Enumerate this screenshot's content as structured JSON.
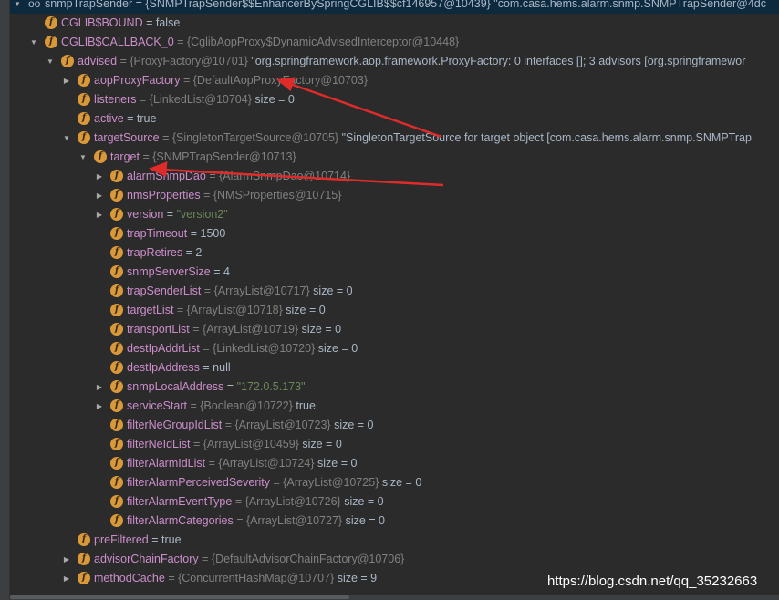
{
  "colors": {
    "background": "#2b2b2b",
    "selected_row": "#0d293e",
    "field_icon": "#d9993a",
    "field_name": "#cc8ecb",
    "reference": "#808080",
    "string": "#6a8759",
    "annotation_arrow": "#e02b2b"
  },
  "rows": [
    {
      "id": "snmp-trap-sender",
      "indent": 0,
      "arrow": "▼",
      "icon": "oo",
      "selected": true,
      "name": "snmpTrapSender",
      "ref": "",
      "value": "= {SNMPTrapSender$$EnhancerBySpringCGLIB$$cf146957@10439} \"com.casa.hems.alarm.snmp.SNMPTrapSender@4dc"
    },
    {
      "id": "cglib-bound",
      "indent": 1,
      "arrow": "",
      "icon": "f",
      "name": "CGLIB$BOUND",
      "ref": "",
      "value": "= false"
    },
    {
      "id": "cglib-callback-0",
      "indent": 1,
      "arrow": "▼",
      "icon": "f",
      "name": "CGLIB$CALLBACK_0",
      "ref": "= {CglibAopProxy$DynamicAdvisedInterceptor@10448}",
      "value": ""
    },
    {
      "id": "advised",
      "indent": 2,
      "arrow": "▼",
      "icon": "f",
      "name": "advised",
      "ref": "= {ProxyFactory@10701}",
      "value": "\"org.springframework.aop.framework.ProxyFactory: 0 interfaces []; 3 advisors [org.springframewor"
    },
    {
      "id": "aop-proxy-factory",
      "indent": 3,
      "arrow": "▶",
      "icon": "f",
      "name": "aopProxyFactory",
      "ref": "= {DefaultAopProxyFactory@10703}",
      "value": ""
    },
    {
      "id": "listeners",
      "indent": 3,
      "arrow": "",
      "icon": "f",
      "name": "listeners",
      "ref": "= {LinkedList@10704}",
      "value": "size = 0"
    },
    {
      "id": "active",
      "indent": 3,
      "arrow": "",
      "icon": "f",
      "name": "active",
      "ref": "",
      "value": "= true"
    },
    {
      "id": "target-source",
      "indent": 3,
      "arrow": "▼",
      "icon": "f",
      "name": "targetSource",
      "ref": "= {SingletonTargetSource@10705}",
      "value": "\"SingletonTargetSource for target object [com.casa.hems.alarm.snmp.SNMPTrap"
    },
    {
      "id": "target",
      "indent": 4,
      "arrow": "▼",
      "icon": "f",
      "name": "target",
      "ref": "= {SNMPTrapSender@10713}",
      "value": ""
    },
    {
      "id": "alarm-snmp-dao",
      "indent": 5,
      "arrow": "▶",
      "icon": "f",
      "name": "alarmSnmpDao",
      "ref": "= {AlarmSnmpDao@10714}",
      "value": ""
    },
    {
      "id": "nms-properties",
      "indent": 5,
      "arrow": "▶",
      "icon": "f",
      "name": "nmsProperties",
      "ref": "= {NMSProperties@10715}",
      "value": ""
    },
    {
      "id": "version",
      "indent": 5,
      "arrow": "▶",
      "icon": "f",
      "name": "version",
      "ref": "=",
      "str": "\"version2\"",
      "value": ""
    },
    {
      "id": "trap-timeout",
      "indent": 5,
      "arrow": "",
      "icon": "f",
      "name": "trapTimeout",
      "ref": "",
      "value": "= 1500"
    },
    {
      "id": "trap-retires",
      "indent": 5,
      "arrow": "",
      "icon": "f",
      "name": "trapRetires",
      "ref": "",
      "value": "= 2"
    },
    {
      "id": "snmp-server-size",
      "indent": 5,
      "arrow": "",
      "icon": "f",
      "name": "snmpServerSize",
      "ref": "",
      "value": "= 4"
    },
    {
      "id": "trap-sender-list",
      "indent": 5,
      "arrow": "",
      "icon": "f",
      "name": "trapSenderList",
      "ref": "= {ArrayList@10717}",
      "value": "size = 0"
    },
    {
      "id": "target-list",
      "indent": 5,
      "arrow": "",
      "icon": "f",
      "name": "targetList",
      "ref": "= {ArrayList@10718}",
      "value": "size = 0"
    },
    {
      "id": "transport-list",
      "indent": 5,
      "arrow": "",
      "icon": "f",
      "name": "transportList",
      "ref": "= {ArrayList@10719}",
      "value": "size = 0"
    },
    {
      "id": "dest-ip-addr-list",
      "indent": 5,
      "arrow": "",
      "icon": "f",
      "name": "destIpAddrList",
      "ref": "= {LinkedList@10720}",
      "value": "size = 0"
    },
    {
      "id": "dest-ip-address",
      "indent": 5,
      "arrow": "",
      "icon": "f",
      "name": "destIpAddress",
      "ref": "",
      "value": "= null"
    },
    {
      "id": "snmp-local-address",
      "indent": 5,
      "arrow": "▶",
      "icon": "f",
      "name": "snmpLocalAddress",
      "ref": "=",
      "str": "\"172.0.5.173\"",
      "value": ""
    },
    {
      "id": "service-start",
      "indent": 5,
      "arrow": "▶",
      "icon": "f",
      "name": "serviceStart",
      "ref": "= {Boolean@10722}",
      "value": "true"
    },
    {
      "id": "filter-ne-group-id-list",
      "indent": 5,
      "arrow": "",
      "icon": "f",
      "name": "filterNeGroupIdList",
      "ref": "= {ArrayList@10723}",
      "value": "size = 0"
    },
    {
      "id": "filter-ne-id-list",
      "indent": 5,
      "arrow": "",
      "icon": "f",
      "name": "filterNeIdList",
      "ref": "= {ArrayList@10459}",
      "value": "size = 0"
    },
    {
      "id": "filter-alarm-id-list",
      "indent": 5,
      "arrow": "",
      "icon": "f",
      "name": "filterAlarmIdList",
      "ref": "= {ArrayList@10724}",
      "value": "size = 0"
    },
    {
      "id": "filter-alarm-perceived-severity",
      "indent": 5,
      "arrow": "",
      "icon": "f",
      "name": "filterAlarmPerceivedSeverity",
      "ref": "= {ArrayList@10725}",
      "value": "size = 0"
    },
    {
      "id": "filter-alarm-event-type",
      "indent": 5,
      "arrow": "",
      "icon": "f",
      "name": "filterAlarmEventType",
      "ref": "= {ArrayList@10726}",
      "value": "size = 0"
    },
    {
      "id": "filter-alarm-categories",
      "indent": 5,
      "arrow": "",
      "icon": "f",
      "name": "filterAlarmCategories",
      "ref": "= {ArrayList@10727}",
      "value": "size = 0"
    },
    {
      "id": "pre-filtered",
      "indent": 3,
      "arrow": "",
      "icon": "f",
      "name": "preFiltered",
      "ref": "",
      "value": "= true"
    },
    {
      "id": "advisor-chain-factory",
      "indent": 3,
      "arrow": "▶",
      "icon": "f",
      "name": "advisorChainFactory",
      "ref": "= {DefaultAdvisorChainFactory@10706}",
      "value": ""
    },
    {
      "id": "method-cache",
      "indent": 3,
      "arrow": "▶",
      "icon": "f",
      "name": "methodCache",
      "ref": "= {ConcurrentHashMap@10707}",
      "value": "size = 9"
    }
  ],
  "watermark": "https://blog.csdn.net/qq_35232663"
}
